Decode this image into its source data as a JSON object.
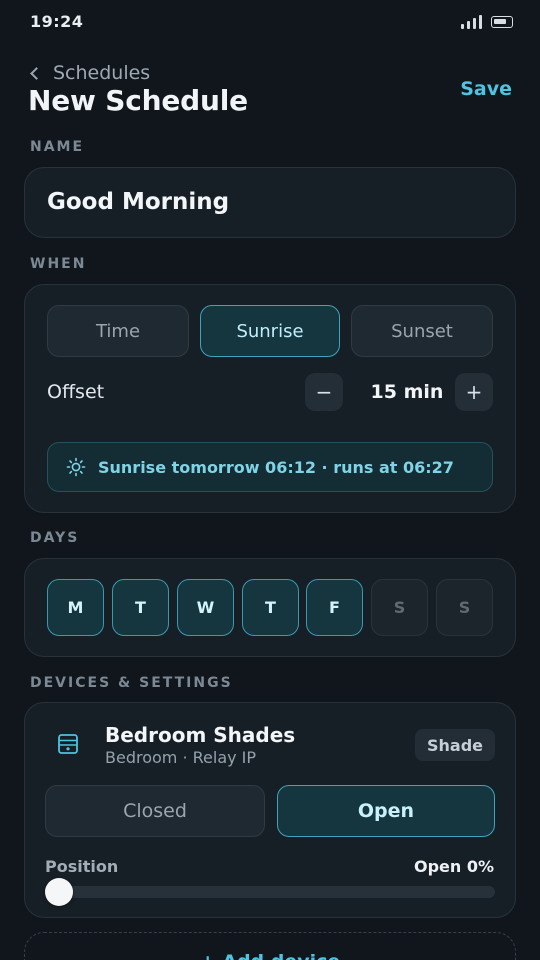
{
  "status": {
    "time": "19:24"
  },
  "header": {
    "back_label": "Schedules",
    "title": "New Schedule",
    "save_label": "Save"
  },
  "name_section": {
    "label": "NAME",
    "value": "Good Morning"
  },
  "when_section": {
    "label": "WHEN",
    "options": [
      "Time",
      "Sunrise",
      "Sunset"
    ],
    "selected": "Sunrise",
    "offset_label": "Offset",
    "offset_value": "15 min",
    "minus": "−",
    "plus": "+",
    "info": "Sunrise tomorrow 06:12 · runs at 06:27",
    "info_icon": "sun-icon"
  },
  "days_section": {
    "label": "DAYS",
    "days": [
      {
        "label": "M",
        "on": true
      },
      {
        "label": "T",
        "on": true
      },
      {
        "label": "W",
        "on": true
      },
      {
        "label": "T",
        "on": true
      },
      {
        "label": "F",
        "on": true
      },
      {
        "label": "S",
        "on": false
      },
      {
        "label": "S",
        "on": false
      }
    ]
  },
  "devices_section": {
    "label": "DEVICES & SETTINGS",
    "device": {
      "icon": "shade-icon",
      "name": "Bedroom Shades",
      "subtitle": "Bedroom · Relay IP",
      "type_badge": "Shade",
      "modes": [
        "Closed",
        "Open"
      ],
      "selected_mode": "Open",
      "position_label": "Position",
      "position_value": "Open 0%",
      "position_percent": 0
    },
    "add_label": "+ Add device"
  },
  "colors": {
    "accent": "#4fc3e0",
    "background": "#10161c",
    "card": "#171f26"
  }
}
